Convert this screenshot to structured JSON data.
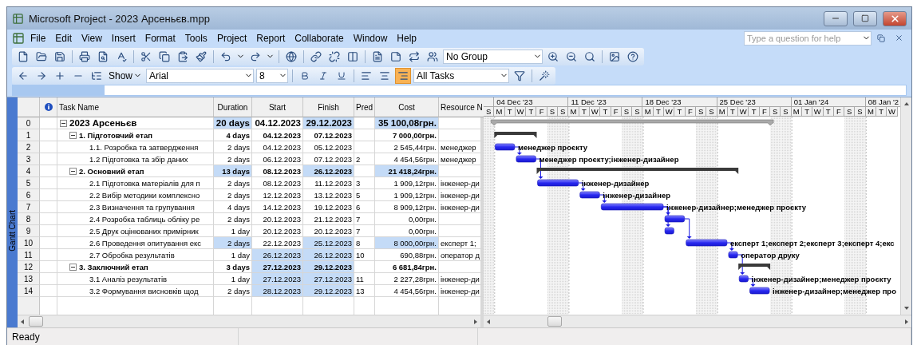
{
  "window": {
    "title": "Microsoft Project - 2023 Арсеньєв.mpp"
  },
  "menu": [
    "File",
    "Edit",
    "View",
    "Insert",
    "Format",
    "Tools",
    "Project",
    "Report",
    "Collaborate",
    "Window",
    "Help"
  ],
  "help_search": {
    "placeholder": "Type a question for help"
  },
  "toolbar": {
    "group": "No Group",
    "show": "Show",
    "font": "Arial",
    "size": "8",
    "filter": "All Tasks",
    "alignment": [
      {
        "kind": "left",
        "selected": false
      },
      {
        "kind": "center",
        "selected": false
      },
      {
        "kind": "right",
        "selected": true
      }
    ]
  },
  "view_bar": {
    "label": "Gantt Chart"
  },
  "table": {
    "columns": [
      "Task Name",
      "Duration",
      "Start",
      "Finish",
      "Pred",
      "Cost",
      "Resource N"
    ],
    "tasks": [
      {
        "id": "0",
        "kind": "project",
        "expanded": true,
        "name": "2023 Арсеньєв",
        "duration": {
          "text": "20 days",
          "highlighted": true
        },
        "start": {
          "text": "04.12.2023",
          "highlighted": false
        },
        "finish": {
          "text": "29.12.2023",
          "highlighted": true
        },
        "cost": {
          "text": "35 100,08грн.",
          "highlighted": true
        },
        "children": [
          {
            "id": "1",
            "kind": "summary",
            "expanded": true,
            "name": "1. Підготовчий етап",
            "duration": {
              "text": "4 days",
              "highlighted": false
            },
            "start": {
              "text": "04.12.2023",
              "highlighted": false
            },
            "finish": {
              "text": "07.12.2023",
              "highlighted": false
            },
            "cost": {
              "text": "7 000,00грн.",
              "highlighted": false
            },
            "children": [
              {
                "id": "2",
                "kind": "task",
                "name": "1.1. Розробка та затвердження",
                "duration": {
                  "text": "2 days",
                  "highlighted": false
                },
                "start": {
                  "text": "04.12.2023",
                  "highlighted": false
                },
                "finish": {
                  "text": "05.12.2023",
                  "highlighted": false
                },
                "cost": {
                  "text": "2 545,44грн.",
                  "highlighted": false
                },
                "resource": "менеджер",
                "bar_label": "менеджер проєкту"
              },
              {
                "id": "3",
                "kind": "task",
                "name": "1.2 Підготовка та збір даних",
                "duration": {
                  "text": "2 days",
                  "highlighted": false
                },
                "start": {
                  "text": "06.12.2023",
                  "highlighted": false
                },
                "finish": {
                  "text": "07.12.2023",
                  "highlighted": false
                },
                "pred": "2",
                "cost": {
                  "text": "4 454,56грн.",
                  "highlighted": false
                },
                "resource": "менеджер",
                "bar_label": "менеджер проєкту;інженер-дизайнер"
              }
            ]
          },
          {
            "id": "4",
            "kind": "summary",
            "expanded": true,
            "name": "2. Основний етап",
            "duration": {
              "text": "13 days",
              "highlighted": true
            },
            "start": {
              "text": "08.12.2023",
              "highlighted": false
            },
            "finish": {
              "text": "26.12.2023",
              "highlighted": true
            },
            "cost": {
              "text": "21 418,24грн.",
              "highlighted": true
            },
            "children": [
              {
                "id": "5",
                "kind": "task",
                "name": "2.1 Підготовка матеріалів для п",
                "duration": {
                  "text": "2 days",
                  "highlighted": false
                },
                "start": {
                  "text": "08.12.2023",
                  "highlighted": false
                },
                "finish": {
                  "text": "11.12.2023",
                  "highlighted": false
                },
                "pred": "3",
                "cost": {
                  "text": "1 909,12грн.",
                  "highlighted": false
                },
                "resource": "інженер-ди",
                "bar_label": "інженер-дизайнер"
              },
              {
                "id": "6",
                "kind": "task",
                "name": "2.2 Вибір методики комплексно",
                "duration": {
                  "text": "2 days",
                  "highlighted": false
                },
                "start": {
                  "text": "12.12.2023",
                  "highlighted": false
                },
                "finish": {
                  "text": "13.12.2023",
                  "highlighted": false
                },
                "pred": "5",
                "cost": {
                  "text": "1 909,12грн.",
                  "highlighted": false
                },
                "resource": "інженер-ди",
                "bar_label": "інженер-дизайнер"
              },
              {
                "id": "7",
                "kind": "task",
                "name": "2.3 Визначення та групування",
                "duration": {
                  "text": "4 days",
                  "highlighted": false
                },
                "start": {
                  "text": "14.12.2023",
                  "highlighted": false
                },
                "finish": {
                  "text": "19.12.2023",
                  "highlighted": false
                },
                "pred": "6",
                "cost": {
                  "text": "8 909,12грн.",
                  "highlighted": false
                },
                "resource": "інженер-ди",
                "bar_label": "інженер-дизайнер;менеджер проєкту"
              },
              {
                "id": "8",
                "kind": "task",
                "name": "2.4 Розробка таблиць обліку ре",
                "duration": {
                  "text": "2 days",
                  "highlighted": false
                },
                "start": {
                  "text": "20.12.2023",
                  "highlighted": false
                },
                "finish": {
                  "text": "21.12.2023",
                  "highlighted": false
                },
                "pred": "7",
                "cost": {
                  "text": "0,00грн.",
                  "highlighted": false
                }
              },
              {
                "id": "9",
                "kind": "task",
                "name": "2.5 Друк оцінюваних примірник",
                "duration": {
                  "text": "1 day",
                  "highlighted": false
                },
                "start": {
                  "text": "20.12.2023",
                  "highlighted": false
                },
                "finish": {
                  "text": "20.12.2023",
                  "highlighted": false
                },
                "pred": "7",
                "cost": {
                  "text": "0,00грн.",
                  "highlighted": false
                }
              },
              {
                "id": "10",
                "kind": "task",
                "name": "2.6 Проведення опитування екс",
                "duration": {
                  "text": "2 days",
                  "highlighted": true
                },
                "start": {
                  "text": "22.12.2023",
                  "highlighted": false
                },
                "finish": {
                  "text": "25.12.2023",
                  "highlighted": true
                },
                "pred": "8",
                "cost": {
                  "text": "8 000,00грн.",
                  "highlighted": true
                },
                "resource": "експерт 1;",
                "bar_label": "експерт 1;експерт 2;експерт 3;експерт 4;екс"
              },
              {
                "id": "11",
                "kind": "task",
                "name": "2.7 Обробка результатів",
                "duration": {
                  "text": "1 day",
                  "highlighted": false
                },
                "start": {
                  "text": "26.12.2023",
                  "highlighted": true
                },
                "finish": {
                  "text": "26.12.2023",
                  "highlighted": true
                },
                "pred": "10",
                "cost": {
                  "text": "690,88грн.",
                  "highlighted": false
                },
                "resource": "оператор д",
                "bar_label": "оператор друку"
              }
            ]
          },
          {
            "id": "12",
            "kind": "summary",
            "expanded": true,
            "name": "3. Заключний етап",
            "duration": {
              "text": "3 days",
              "highlighted": false
            },
            "start": {
              "text": "27.12.2023",
              "highlighted": true
            },
            "finish": {
              "text": "29.12.2023",
              "highlighted": true
            },
            "cost": {
              "text": "6 681,84грн.",
              "highlighted": false
            },
            "children": [
              {
                "id": "13",
                "kind": "task",
                "name": "3.1 Аналіз результатів",
                "duration": {
                  "text": "1 day",
                  "highlighted": false
                },
                "start": {
                  "text": "27.12.2023",
                  "highlighted": true
                },
                "finish": {
                  "text": "27.12.2023",
                  "highlighted": true
                },
                "pred": "11",
                "cost": {
                  "text": "2 227,28грн.",
                  "highlighted": false
                },
                "resource": "інженер-ди",
                "bar_label": "інженер-дизайнер;менеджер проєкту"
              },
              {
                "id": "14",
                "kind": "task",
                "name": "3.2 Формування висновків щод",
                "duration": {
                  "text": "2 days",
                  "highlighted": false
                },
                "start": {
                  "text": "28.12.2023",
                  "highlighted": true
                },
                "finish": {
                  "text": "29.12.2023",
                  "highlighted": true
                },
                "pred": "13",
                "cost": {
                  "text": "4 454,56грн.",
                  "highlighted": false
                },
                "resource": "інженер-ди",
                "bar_label": "інженер-дизайнер;менеджер про"
              }
            ]
          }
        ]
      }
    ]
  },
  "timescale": {
    "weeks": [
      "04 Dec '23",
      "11 Dec '23",
      "18 Dec '23",
      "25 Dec '23",
      "01 Jan '24",
      "08 Jan '2"
    ],
    "days": [
      "S",
      "M",
      "T",
      "W",
      "T",
      "F",
      "S",
      "S",
      "M",
      "T",
      "W",
      "T",
      "F",
      "S",
      "S",
      "M",
      "T",
      "W",
      "T",
      "F",
      "S",
      "S",
      "M",
      "T",
      "W",
      "T",
      "F",
      "S",
      "S",
      "M",
      "T",
      "W",
      "T",
      "F",
      "S",
      "S",
      "M",
      "T",
      "W"
    ]
  },
  "status_bar": {
    "text": "Ready"
  }
}
